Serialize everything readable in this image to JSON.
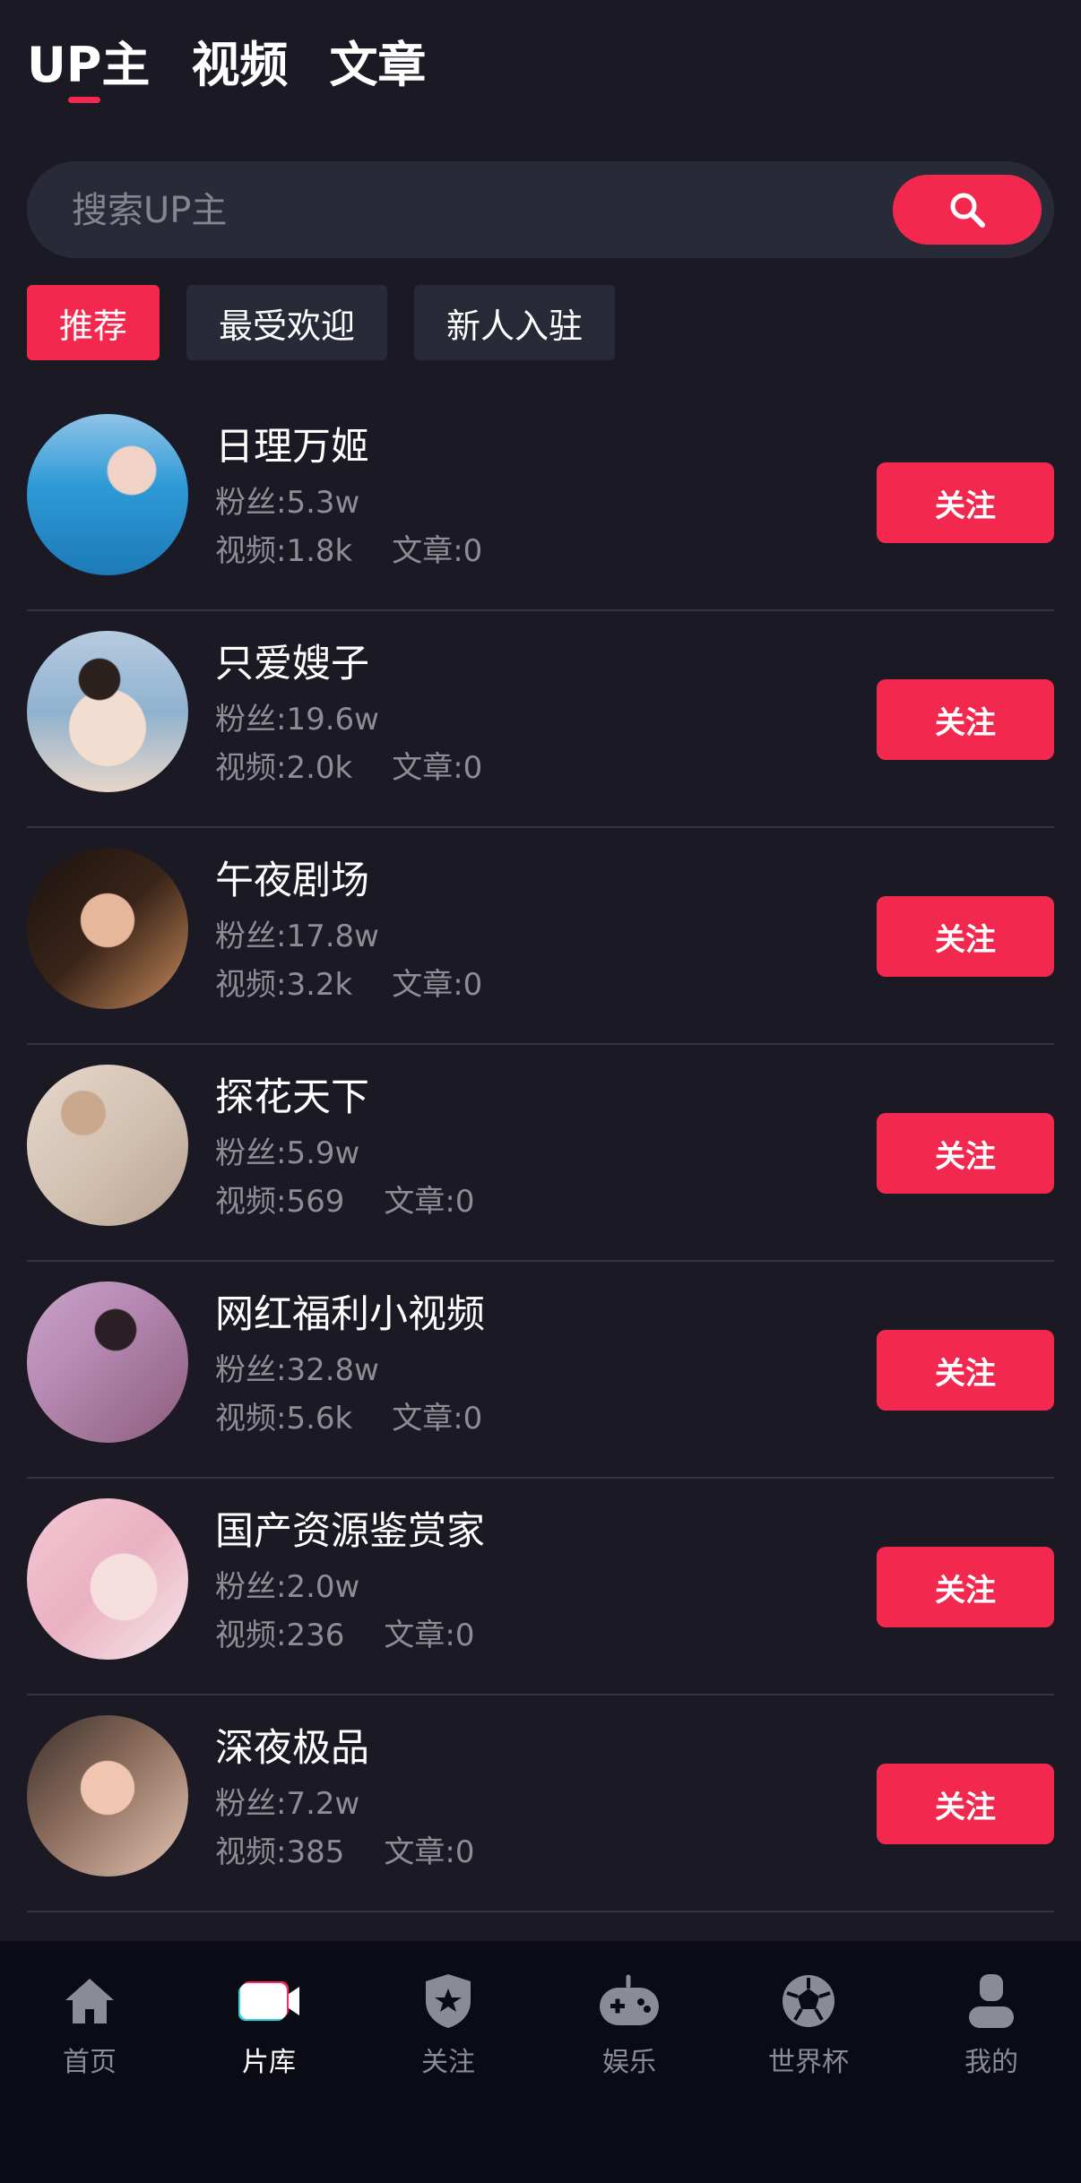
{
  "tabs": [
    {
      "label": "UP主",
      "active": true
    },
    {
      "label": "视频",
      "active": false
    },
    {
      "label": "文章",
      "active": false
    }
  ],
  "search": {
    "placeholder": "搜索UP主"
  },
  "filters": [
    {
      "label": "推荐",
      "active": true
    },
    {
      "label": "最受欢迎",
      "active": false
    },
    {
      "label": "新人入驻",
      "active": false
    }
  ],
  "creators": [
    {
      "name": "日理万姬",
      "fans": "粉丝:5.3w",
      "videos": "视频:1.8k",
      "articles": "文章:0",
      "follow": "关注"
    },
    {
      "name": "只爱嫂子",
      "fans": "粉丝:19.6w",
      "videos": "视频:2.0k",
      "articles": "文章:0",
      "follow": "关注"
    },
    {
      "name": "午夜剧场",
      "fans": "粉丝:17.8w",
      "videos": "视频:3.2k",
      "articles": "文章:0",
      "follow": "关注"
    },
    {
      "name": "探花天下",
      "fans": "粉丝:5.9w",
      "videos": "视频:569",
      "articles": "文章:0",
      "follow": "关注"
    },
    {
      "name": "网红福利小视频",
      "fans": "粉丝:32.8w",
      "videos": "视频:5.6k",
      "articles": "文章:0",
      "follow": "关注"
    },
    {
      "name": "国产资源鉴赏家",
      "fans": "粉丝:2.0w",
      "videos": "视频:236",
      "articles": "文章:0",
      "follow": "关注"
    },
    {
      "name": "深夜极品",
      "fans": "粉丝:7.2w",
      "videos": "视频:385",
      "articles": "文章:0",
      "follow": "关注"
    }
  ],
  "nav": [
    {
      "label": "首页",
      "icon": "home-icon",
      "active": false
    },
    {
      "label": "片库",
      "icon": "video-library-icon",
      "active": true
    },
    {
      "label": "关注",
      "icon": "shield-star-icon",
      "active": false
    },
    {
      "label": "娱乐",
      "icon": "gamepad-icon",
      "active": false
    },
    {
      "label": "世界杯",
      "icon": "soccer-ball-icon",
      "active": false
    },
    {
      "label": "我的",
      "icon": "user-icon",
      "active": false
    }
  ],
  "colors": {
    "accent": "#f2284f",
    "background": "#1b1a24",
    "navBackground": "#0b0b15"
  }
}
